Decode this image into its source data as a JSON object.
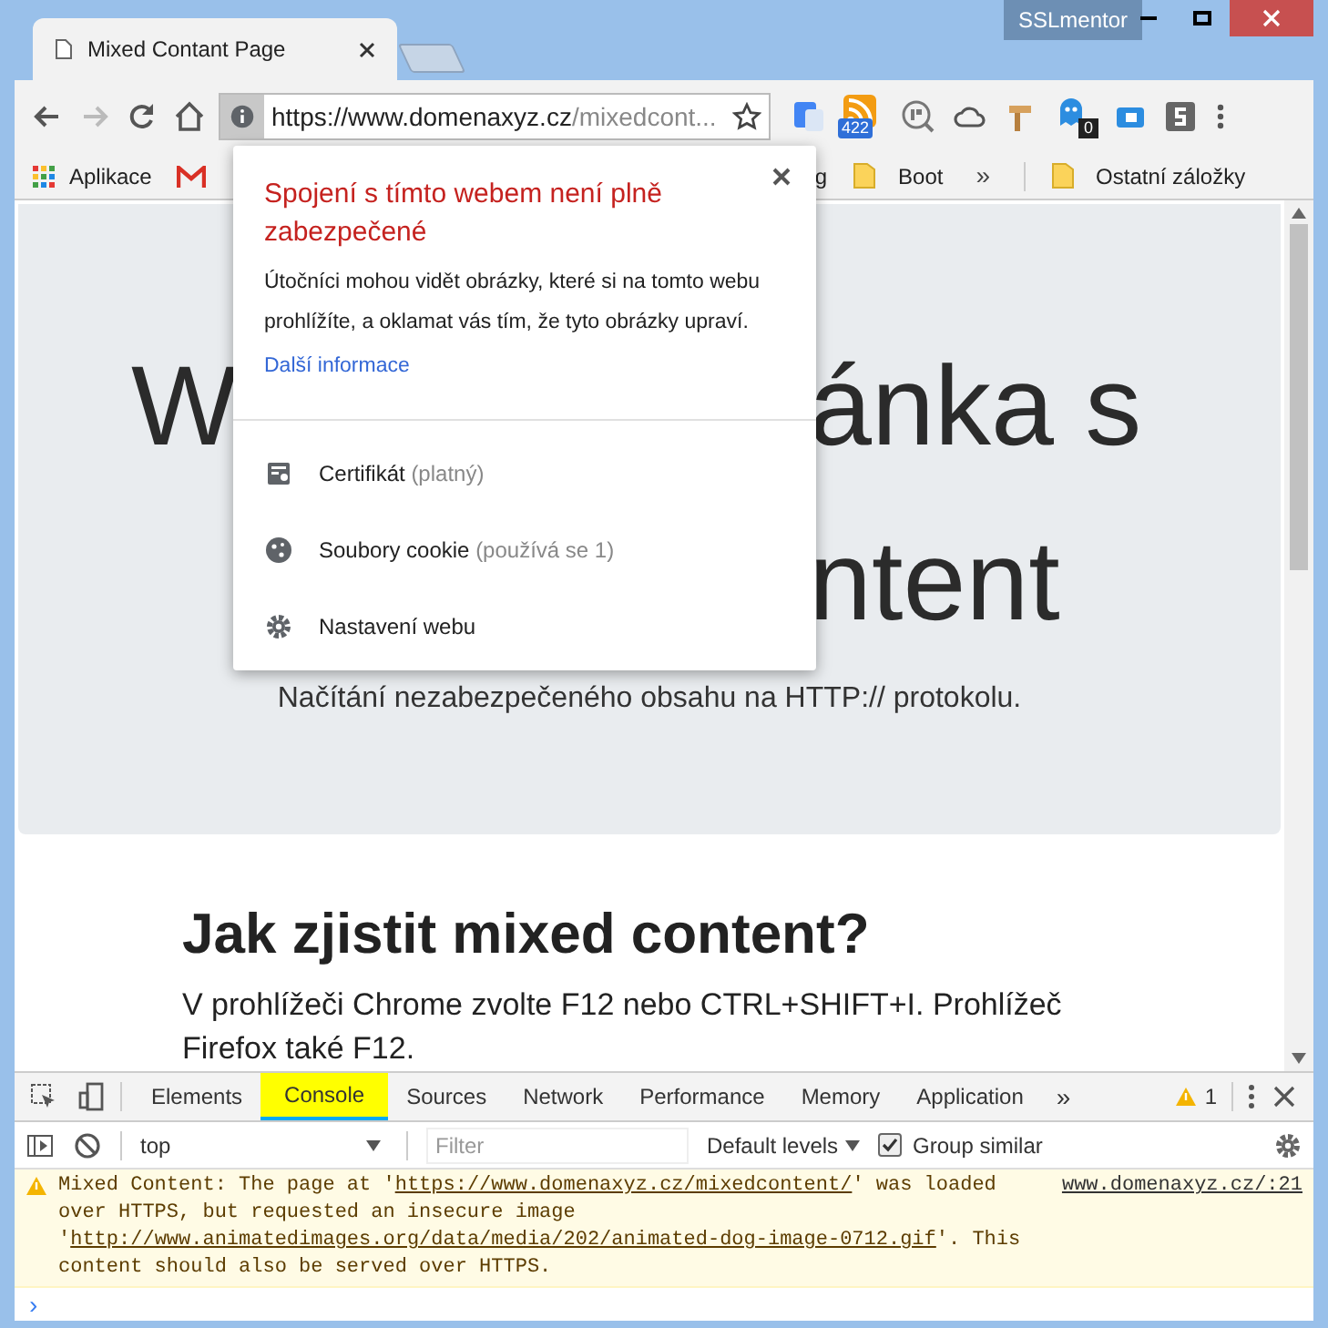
{
  "window": {
    "tab_title": "Mixed Contant Page",
    "profile": "SSLmentor"
  },
  "toolbar": {
    "url_host": "https://www.domenaxyz.cz",
    "url_path": "/mixedcont...",
    "rss_count": "422",
    "ghost_count": "0"
  },
  "bookmarks": [
    {
      "kind": "apps",
      "label": "Aplikace"
    },
    {
      "kind": "gmail"
    },
    {
      "kind": "text",
      "label": "g"
    },
    {
      "kind": "folder",
      "label": "Boot"
    },
    {
      "kind": "more",
      "label": "»"
    },
    {
      "kind": "folder",
      "label": "Ostatní záložky"
    }
  ],
  "popup": {
    "title": "Spojení s tímto webem není plně zabezpečené",
    "body": "Útočníci mohou vidět obrázky, které si na tomto webu prohlížíte, a oklamat vás tím, že tyto obrázky upraví.",
    "link": "Další informace",
    "items": [
      {
        "kind": "certificate",
        "label": "Certifikát",
        "note": "(platný)"
      },
      {
        "kind": "cookie",
        "label": "Soubory cookie",
        "note": "(používá se 1)"
      },
      {
        "kind": "settings",
        "label": "Nastavení webu"
      }
    ]
  },
  "page": {
    "hero_left": "W",
    "hero_right_1": "ánka s",
    "hero_right_2": "ntent",
    "subtitle": "Načítání nezabezpečeného obsahu na HTTP:// protokolu.",
    "heading": "Jak zjistit mixed content?",
    "paragraph": "V prohlížeči Chrome zvolte F12 nebo CTRL+SHIFT+I. Prohlížeč Firefox také F12."
  },
  "devtools": {
    "tabs": [
      {
        "label": "Elements",
        "selected": false
      },
      {
        "label": "Console",
        "selected": true
      },
      {
        "label": "Sources",
        "selected": false
      },
      {
        "label": "Network",
        "selected": false
      },
      {
        "label": "Performance",
        "selected": false
      },
      {
        "label": "Memory",
        "selected": false
      },
      {
        "label": "Application",
        "selected": false
      }
    ],
    "more": "»",
    "warning_count": "1",
    "context": "top",
    "filter_placeholder": "Filter",
    "levels": "Default levels",
    "group_similar": {
      "label": "Group similar",
      "checked": true
    },
    "message": {
      "prefix": "Mixed Content: The page at '",
      "page_link": "https://www.domenaxyz.cz/mixedcontent/",
      "middle": "' was loaded over HTTPS, but requested an insecure image '",
      "image_link": "http://www.animatedimages.org/data/media/202/animated-dog-image-0712.gif",
      "suffix": "'. This content should also be served over HTTPS.",
      "source": "www.domenaxyz.cz/:21"
    },
    "prompt": "›"
  }
}
